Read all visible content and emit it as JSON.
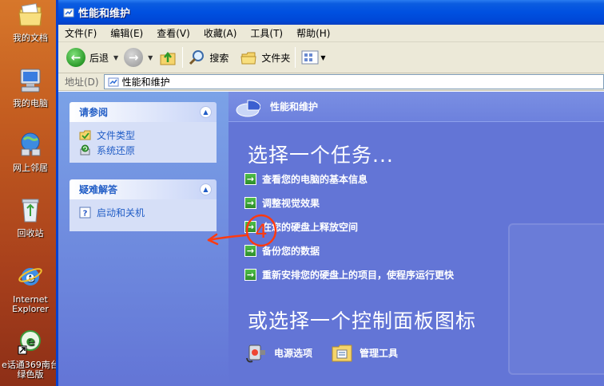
{
  "desktop": {
    "icons": [
      {
        "label": "我的文档",
        "icon": "my-documents-icon"
      },
      {
        "label": "我的电脑",
        "icon": "my-computer-icon"
      },
      {
        "label": "网上邻居",
        "icon": "network-places-icon"
      },
      {
        "label": "回收站",
        "icon": "recycle-bin-icon"
      },
      {
        "label": "Internet Explorer",
        "icon": "internet-explorer-icon"
      },
      {
        "label": "e话通369南台绿色版",
        "icon": "ehuatong-icon"
      }
    ]
  },
  "window": {
    "title": "性能和维护",
    "menu": [
      "文件(F)",
      "编辑(E)",
      "查看(V)",
      "收藏(A)",
      "工具(T)",
      "帮助(H)"
    ],
    "toolbar": {
      "back_label": "后退",
      "search_label": "搜索",
      "folders_label": "文件夹"
    },
    "address": {
      "label": "地址(D)",
      "value": "性能和维护"
    }
  },
  "sidebar": {
    "see_also": {
      "title": "请参阅",
      "links": [
        "文件类型",
        "系统还原"
      ]
    },
    "troubleshoot": {
      "title": "疑难解答",
      "links": [
        "启动和关机"
      ]
    }
  },
  "main": {
    "header": "性能和维护",
    "pick_task": "选择一个任务...",
    "tasks": [
      "查看您的电脑的基本信息",
      "调整视觉效果",
      "在您的硬盘上释放空间",
      "备份您的数据",
      "重新安排您的硬盘上的项目，使程序运行更快"
    ],
    "pick_icon": "或选择一个控制面板图标",
    "icons": [
      "电源选项",
      "管理工具"
    ]
  },
  "annotation": {
    "label": "4"
  },
  "colors": {
    "titlebar": "#0050e0",
    "left_pane": "#7ba2e7",
    "right_pane": "#6375d6",
    "link": "#215dc6",
    "annotation": "#ff3a10"
  }
}
